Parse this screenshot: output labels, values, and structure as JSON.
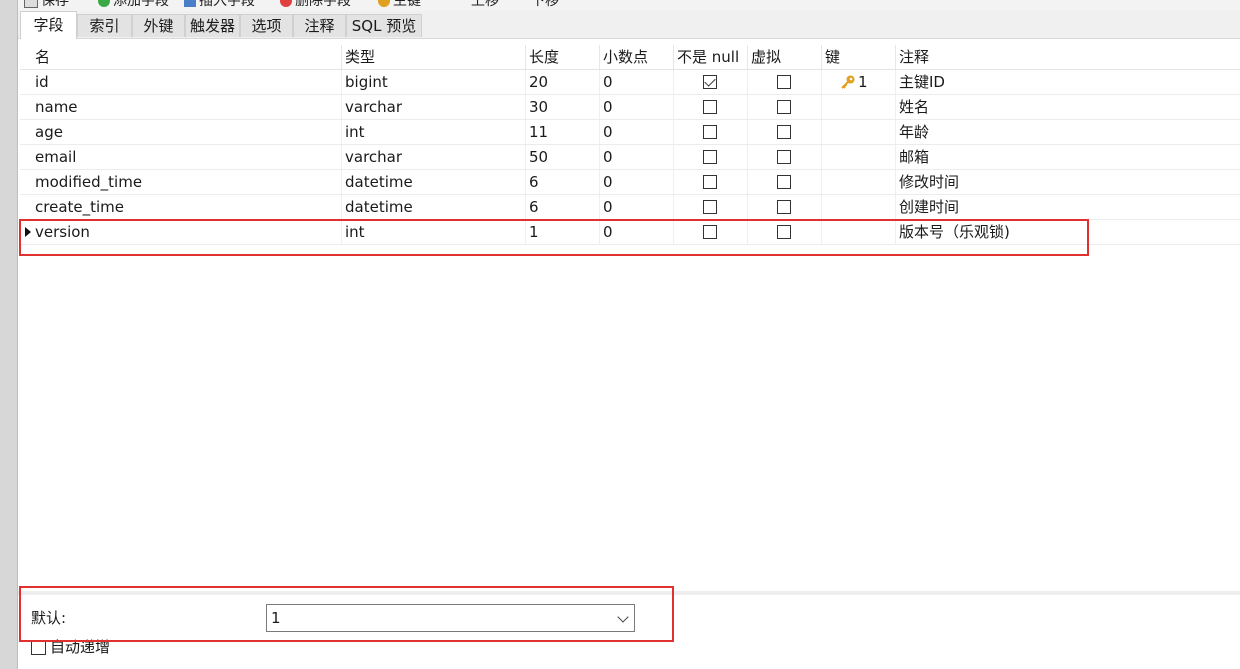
{
  "toolbar": {
    "save": "保存",
    "add_field": "添加字段",
    "insert_field": "插入字段",
    "delete_field": "删除字段",
    "primary_key": "主键",
    "move_up": "上移",
    "move_down": "下移"
  },
  "tabs": [
    {
      "label": "字段",
      "active": true
    },
    {
      "label": "索引"
    },
    {
      "label": "外键"
    },
    {
      "label": "触发器"
    },
    {
      "label": "选项"
    },
    {
      "label": "注释"
    },
    {
      "label": "SQL 预览"
    }
  ],
  "columns": {
    "name": "名",
    "type": "类型",
    "length": "长度",
    "decimals": "小数点",
    "not_null": "不是 null",
    "virtual": "虚拟",
    "key": "键",
    "comment": "注释"
  },
  "rows": [
    {
      "name": "id",
      "type": "bigint",
      "length": "20",
      "decimals": "0",
      "not_null": true,
      "virtual": false,
      "key": "1",
      "comment": "主键ID"
    },
    {
      "name": "name",
      "type": "varchar",
      "length": "30",
      "decimals": "0",
      "not_null": false,
      "virtual": false,
      "key": "",
      "comment": "姓名"
    },
    {
      "name": "age",
      "type": "int",
      "length": "11",
      "decimals": "0",
      "not_null": false,
      "virtual": false,
      "key": "",
      "comment": "年龄"
    },
    {
      "name": "email",
      "type": "varchar",
      "length": "50",
      "decimals": "0",
      "not_null": false,
      "virtual": false,
      "key": "",
      "comment": "邮箱"
    },
    {
      "name": "modified_time",
      "type": "datetime",
      "length": "6",
      "decimals": "0",
      "not_null": false,
      "virtual": false,
      "key": "",
      "comment": "修改时间"
    },
    {
      "name": "create_time",
      "type": "datetime",
      "length": "6",
      "decimals": "0",
      "not_null": false,
      "virtual": false,
      "key": "",
      "comment": "创建时间"
    },
    {
      "name": "version",
      "type": "int",
      "length": "1",
      "decimals": "0",
      "not_null": false,
      "virtual": false,
      "key": "",
      "comment": "版本号（乐观锁)",
      "selected": true
    }
  ],
  "properties": {
    "default_label": "默认:",
    "default_value": "1",
    "auto_increment_label": "自动递增"
  },
  "colors": {
    "highlight": "#e03030",
    "key_icon": "#e0a020"
  },
  "icons": {
    "key": "key-icon",
    "row_pointer": "row-pointer-icon",
    "dropdown": "chevron-down-icon"
  }
}
